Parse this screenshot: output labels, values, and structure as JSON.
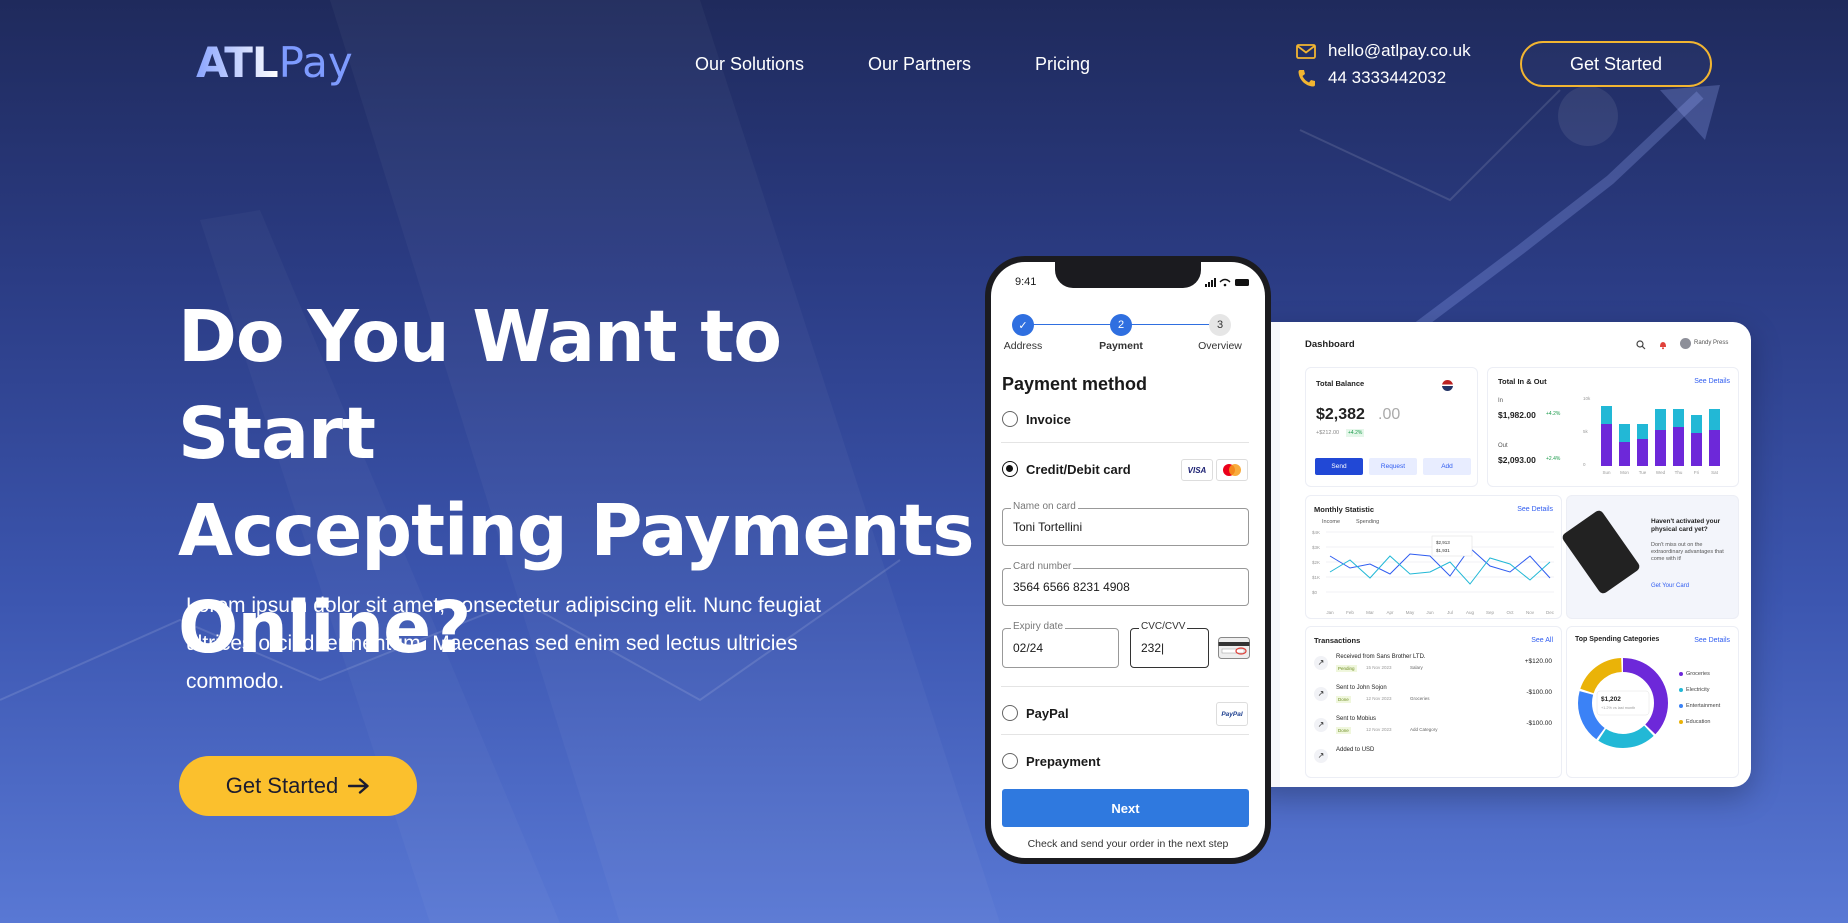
{
  "brand": {
    "logo_atl": "ATL",
    "logo_pay": "Pay"
  },
  "nav": {
    "solutions": "Our Solutions",
    "partners": "Our Partners",
    "pricing": "Pricing"
  },
  "contact": {
    "email": "hello@atlpay.co.uk",
    "phone": "44 3333442032"
  },
  "header": {
    "cta": "Get Started"
  },
  "hero": {
    "line1": "Do You Want to Start",
    "line2": "Accepting Payments",
    "line3": "Online?",
    "paragraph": "Lorem ipsum dolor sit amet, consectetur adipiscing elit. Nunc feugiat ultrices orci id fermentum. Maecenas sed enim sed lectus ultricies commodo.",
    "cta": "Get Started",
    "cta_icon": "arrow-right-icon"
  },
  "phone": {
    "time": "9:41",
    "steps": [
      {
        "num": "✓",
        "label": "Address",
        "state": "done"
      },
      {
        "num": "2",
        "label": "Payment",
        "state": "active"
      },
      {
        "num": "3",
        "label": "Overview",
        "state": "pending"
      }
    ],
    "title": "Payment method",
    "options": {
      "invoice": "Invoice",
      "card": "Credit/Debit card",
      "paypal": "PayPal",
      "prepayment": "Prepayment"
    },
    "selected_option": "Credit/Debit card",
    "card_logos": {
      "visa": "VISA",
      "paypal": "PayPal"
    },
    "fields": {
      "name": {
        "label": "Name on card",
        "value": "Toni Tortellini"
      },
      "number": {
        "label": "Card number",
        "value": "3564 6566 8231 4908"
      },
      "expiry": {
        "label": "Expiry date",
        "value": "02/24"
      },
      "cvc": {
        "label": "CVC/CVV",
        "value": "232|"
      }
    },
    "next": "Next",
    "footnote": "Check and send your order in the next step"
  },
  "dashboard": {
    "title": "Dashboard",
    "user": "Randy Press",
    "total_balance": {
      "label": "Total Balance",
      "whole": "$2,382",
      "cents": ".00",
      "sub": "+$212.00",
      "badge": "+4.2%"
    },
    "actions": {
      "send": "Send",
      "request": "Request",
      "add": "Add"
    },
    "total_in_out": {
      "label": "Total In & Out",
      "see": "See Details",
      "in_label": "In",
      "in_value": "$1,982.00",
      "in_badge": "+4.2%",
      "out_label": "Out",
      "out_value": "$2,093.00",
      "out_badge": "+2.4%"
    },
    "bars": {
      "days": [
        "Sun",
        "Mon",
        "Tue",
        "Wed",
        "Thu",
        "Fri",
        "Sat"
      ],
      "y_ticks": [
        "10k",
        "5k",
        "0"
      ],
      "in": [
        0.7,
        0.4,
        0.45,
        0.6,
        0.65,
        0.55,
        0.6
      ],
      "out": [
        0.3,
        0.3,
        0.25,
        0.35,
        0.3,
        0.3,
        0.35
      ]
    },
    "monthly": {
      "label": "Monthly Statistic",
      "see": "See Details",
      "income": "Income",
      "spending": "Spending",
      "months": [
        "Jan",
        "Feb",
        "Mar",
        "Apr",
        "May",
        "Jun",
        "Jul",
        "Aug",
        "Sep",
        "Oct",
        "Nov",
        "Dec"
      ],
      "y_ticks": [
        "$4K",
        "$3K",
        "$2K",
        "$1K",
        "$0"
      ],
      "tip1": "$2,913",
      "tip2": "$1,931"
    },
    "card_promo": {
      "title": "Haven't activated your physical card yet?",
      "body": "Don't miss out on the extraordinary advantages that come with it!",
      "link": "Get Your Card"
    },
    "transactions": {
      "label": "Transactions",
      "see": "See All",
      "rows": [
        {
          "title": "Received from Sans Brother LTD.",
          "tag": "Pending",
          "date": "15 Nov 2023",
          "category": "Salary",
          "amount": "+$120.00"
        },
        {
          "title": "Sent to John Sojon",
          "tag": "Done",
          "date": "12 Nov 2023",
          "category": "Groceries",
          "amount": "-$100.00"
        },
        {
          "title": "Sent to Mobius",
          "tag": "Done",
          "date": "12 Nov 2023",
          "category": "Add Category",
          "amount": "-$100.00"
        },
        {
          "title": "Added to USD",
          "tag": "",
          "date": "",
          "category": "",
          "amount": ""
        }
      ]
    },
    "spending": {
      "label": "Top Spending Categories",
      "see": "See Details",
      "center": "$1,202",
      "center_sub": "+1.2% vs last month",
      "categories": [
        "Groceries",
        "Electricity",
        "Entertainment",
        "Education"
      ],
      "shares": [
        0.38,
        0.22,
        0.2,
        0.2
      ],
      "colors": [
        "#6d28d9",
        "#22b8d6",
        "#3b82f6",
        "#eab308"
      ]
    }
  }
}
